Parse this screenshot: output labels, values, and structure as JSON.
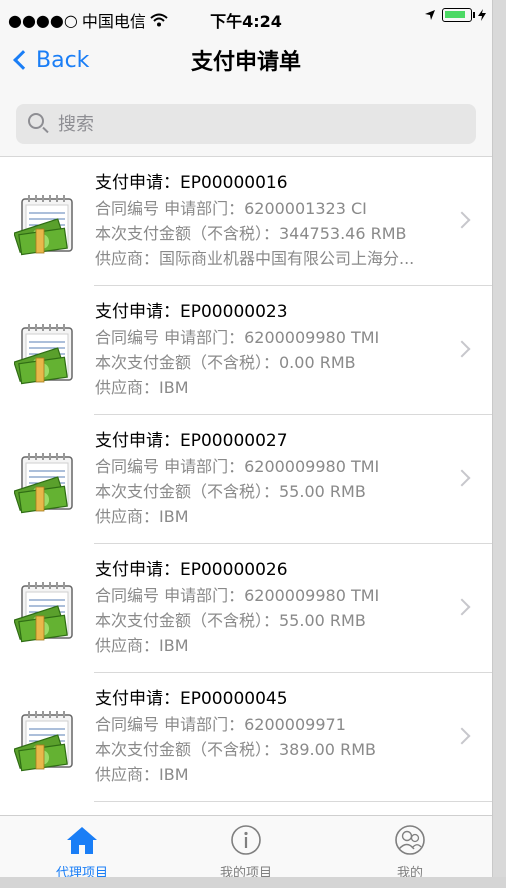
{
  "status_bar": {
    "signal": "●●●●○",
    "carrier": "中国电信",
    "time": "下午4:24"
  },
  "nav": {
    "back_label": "Back",
    "title": "支付申请单"
  },
  "search": {
    "placeholder": "搜索"
  },
  "rows": [
    {
      "title": "支付申请：EP00000016",
      "line1": "合同编号 申请部门：6200001323 CI",
      "line2": "本次支付金额（不含税）：344753.46 RMB",
      "line3": "供应商：国际商业机器中国有限公司上海分..."
    },
    {
      "title": "支付申请：EP00000023",
      "line1": "合同编号 申请部门：6200009980 TMI",
      "line2": "本次支付金额（不含税）：0.00 RMB",
      "line3": "供应商：IBM"
    },
    {
      "title": "支付申请：EP00000027",
      "line1": "合同编号 申请部门：6200009980 TMI",
      "line2": "本次支付金额（不含税）：55.00 RMB",
      "line3": "供应商：IBM"
    },
    {
      "title": "支付申请：EP00000026",
      "line1": "合同编号 申请部门：6200009980 TMI",
      "line2": "本次支付金额（不含税）：55.00 RMB",
      "line3": "供应商：IBM"
    },
    {
      "title": "支付申请：EP00000045",
      "line1": "合同编号 申请部门：6200009971",
      "line2": "本次支付金额（不含税）：389.00 RMB",
      "line3": "供应商：IBM"
    }
  ],
  "tabs": [
    {
      "label": "代理项目",
      "icon": "home-icon",
      "active": true
    },
    {
      "label": "我的项目",
      "icon": "info-icon",
      "active": false
    },
    {
      "label": "我的",
      "icon": "user-icon",
      "active": false
    }
  ],
  "colors": {
    "accent": "#1a7ef6",
    "battery": "#4cd964"
  }
}
